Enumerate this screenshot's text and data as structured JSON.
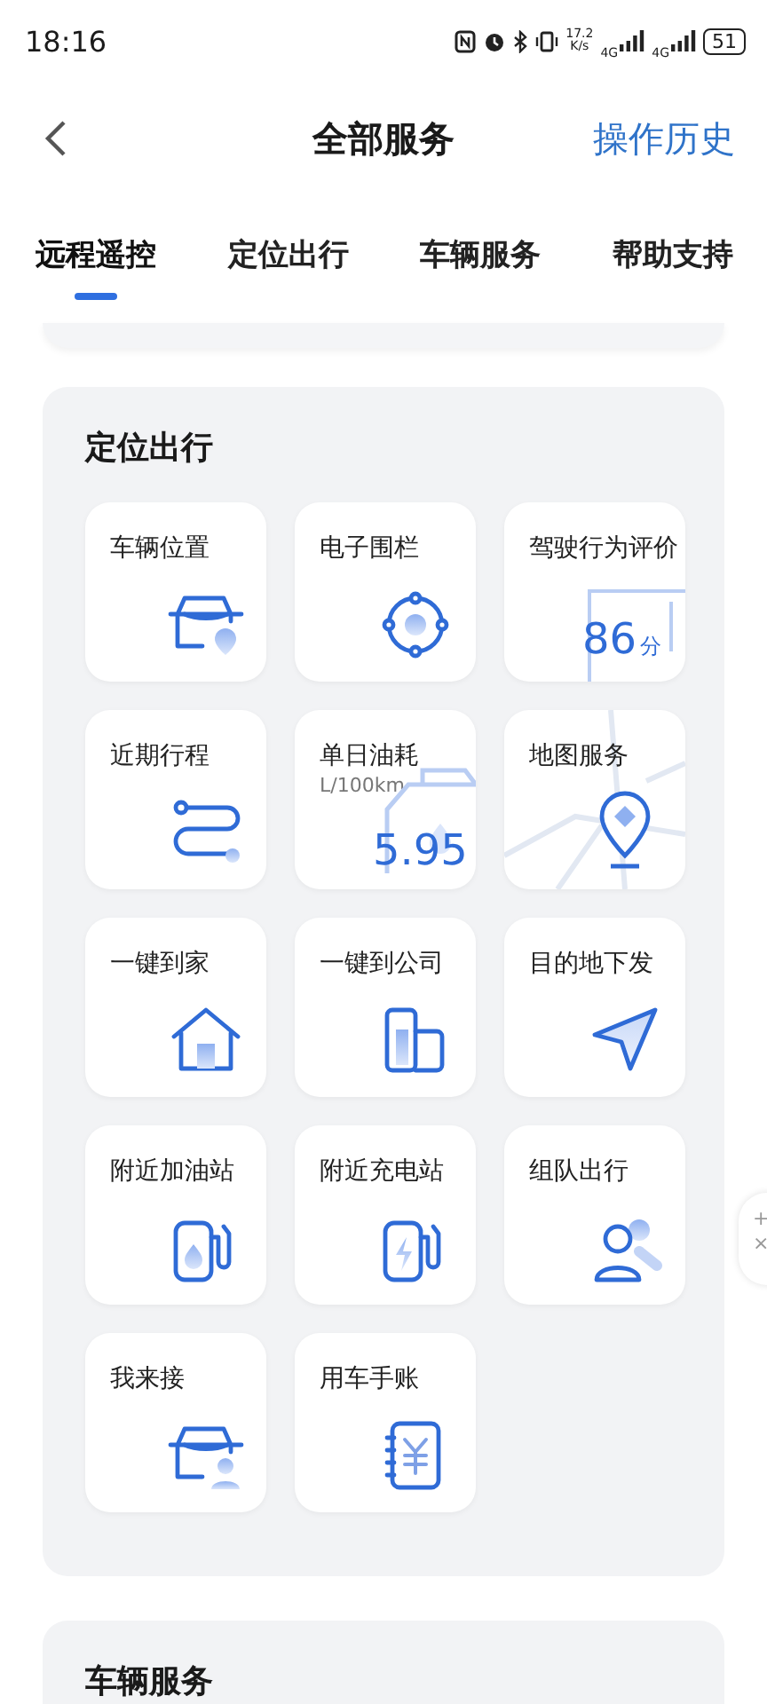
{
  "status_bar": {
    "time": "18:16",
    "speed": "17.2",
    "speed_unit": "K/s",
    "networks": [
      "4G",
      "4G"
    ],
    "battery": "51"
  },
  "header": {
    "title": "全部服务",
    "action": "操作历史"
  },
  "tabs": [
    {
      "label": "远程遥控",
      "selected": true
    },
    {
      "label": "定位出行",
      "selected": false
    },
    {
      "label": "车辆服务",
      "selected": false
    },
    {
      "label": "帮助支持",
      "selected": false
    }
  ],
  "section": {
    "title": "定位出行",
    "tiles": [
      {
        "label": "车辆位置",
        "kind": "icon"
      },
      {
        "label": "电子围栏",
        "kind": "icon"
      },
      {
        "label": "驾驶行为评价",
        "kind": "score",
        "value": "86",
        "unit": "分"
      },
      {
        "label": "近期行程",
        "kind": "icon"
      },
      {
        "label": "单日油耗",
        "kind": "fuel",
        "unit": "L/100km",
        "value": "5.95"
      },
      {
        "label": "地图服务",
        "kind": "map"
      },
      {
        "label": "一键到家",
        "kind": "icon"
      },
      {
        "label": "一键到公司",
        "kind": "icon"
      },
      {
        "label": "目的地下发",
        "kind": "icon"
      },
      {
        "label": "附近加油站",
        "kind": "icon"
      },
      {
        "label": "附近充电站",
        "kind": "icon"
      },
      {
        "label": "组队出行",
        "kind": "icon"
      },
      {
        "label": "我来接",
        "kind": "icon"
      },
      {
        "label": "用车手账",
        "kind": "icon"
      }
    ]
  },
  "next_section": {
    "title": "车辆服务"
  },
  "floating_tool": {
    "symbols": [
      "+",
      "×"
    ]
  }
}
